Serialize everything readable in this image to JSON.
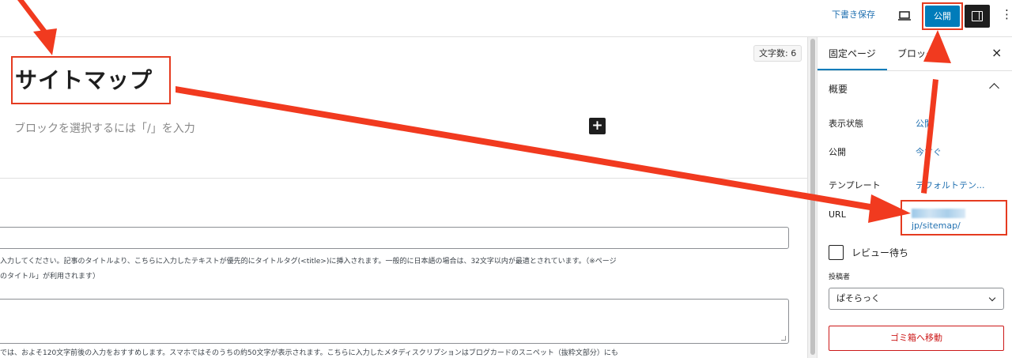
{
  "header": {
    "save_draft_label": "下書き保存",
    "preview_icon": "laptop-icon",
    "publish_label": "公開",
    "settings_icon": "sidebar-toggle-icon",
    "more_icon": "vertical-dots-icon",
    "more_glyph": "⋮"
  },
  "editor": {
    "word_count": "文字数: 6",
    "page_title": "サイトマップ",
    "block_placeholder": "ブロックを選択するには「/」を入力",
    "add_block_glyph": "+",
    "meta_collapse_glyph": "^",
    "title_help": "入力してください。記事のタイトルより、こちらに入力したテキストが優先的にタイトルタグ(<title>)に挿入されます。一般的に日本語の場合は、32文字以内が最適とされています。（※ページ\nのタイトル」が利用されます）",
    "title_input_value": "",
    "description_input_value": "",
    "description_help": "では、およそ120文字前後の入力をおすすめします。スマホではそのうちの約50文字が表示されます。こちらに入力したメタディスクリプションはブログカードのスニペット（抜粋文部分）にも"
  },
  "sidebar": {
    "tabs": [
      {
        "label": "固定ページ",
        "active": true
      },
      {
        "label": "ブロック",
        "active": false
      }
    ],
    "close_glyph": "×",
    "summary_title": "概要",
    "rows": [
      {
        "label": "表示状態",
        "value": "公開"
      },
      {
        "label": "公開",
        "value": "今すぐ"
      },
      {
        "label": "テンプレート",
        "value": "デフォルトテン..."
      },
      {
        "label": "URL",
        "value_suffix": "jp/sitemap/"
      }
    ],
    "pending_review_label": "レビュー待ち",
    "pending_review_checked": false,
    "author_label": "投稿者",
    "author_value": "ぱそらっく",
    "trash_label": "ゴミ箱へ移動"
  },
  "colors": {
    "accent": "#007cba",
    "annotation_red": "#e53b20",
    "danger": "#cc1818",
    "link": "#2271b1"
  }
}
